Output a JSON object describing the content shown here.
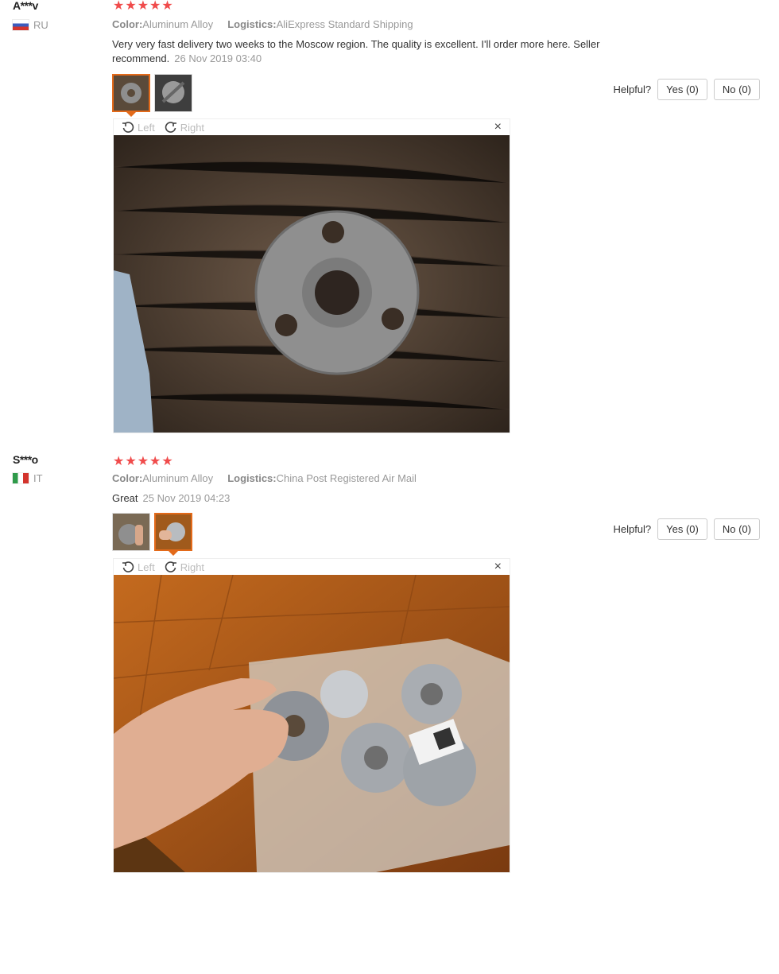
{
  "reviews": [
    {
      "user": "A***v",
      "country": "RU",
      "stars": "★★★★★",
      "color_label": "Color:",
      "color_value": "Aluminum Alloy",
      "logistics_label": "Logistics:",
      "logistics_value": "AliExpress Standard Shipping",
      "text": "Very very fast delivery two weeks to the Moscow region. The quality is excellent. I'll order more here. Seller recommend.",
      "date": "26 Nov 2019 03:40",
      "helpful_label": "Helpful?",
      "yes_label": "Yes (0)",
      "no_label": "No (0)",
      "rotate_left": "Left",
      "rotate_right": "Right",
      "close": "×"
    },
    {
      "user": "S***o",
      "country": "IT",
      "stars": "★★★★★",
      "color_label": "Color:",
      "color_value": "Aluminum Alloy",
      "logistics_label": "Logistics:",
      "logistics_value": "China Post Registered Air Mail",
      "text": "Great",
      "date": "25 Nov 2019 04:23",
      "helpful_label": "Helpful?",
      "yes_label": "Yes (0)",
      "no_label": "No (0)",
      "rotate_left": "Left",
      "rotate_right": "Right",
      "close": "×"
    }
  ]
}
